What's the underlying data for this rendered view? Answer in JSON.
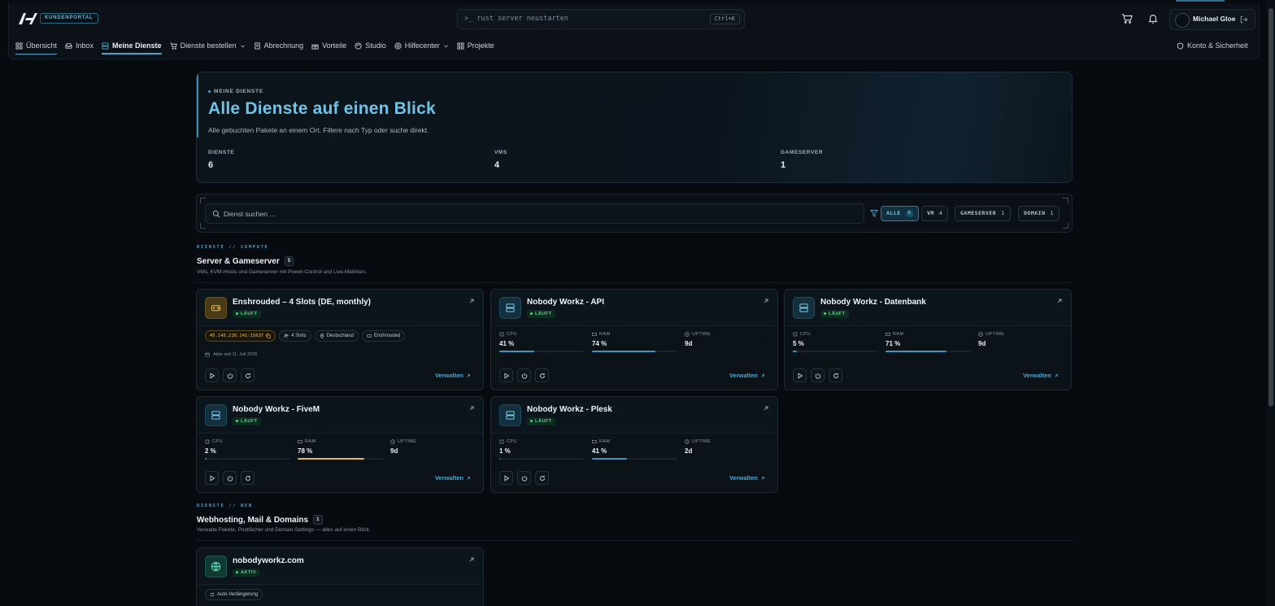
{
  "header": {
    "portal_badge": "KUNDENPORTAL",
    "command_placeholder": ">_ rust server neustarten",
    "command_shortcut": "Ctrl+K",
    "user_name": "Michael Gloe"
  },
  "nav": {
    "items": [
      {
        "label": "Übersicht",
        "icon": "grid-icon"
      },
      {
        "label": "Inbox",
        "icon": "inbox-icon"
      },
      {
        "label": "Meine Dienste",
        "icon": "server-icon"
      },
      {
        "label": "Dienste bestellen",
        "icon": "cart-icon"
      },
      {
        "label": "Abrechnung",
        "icon": "receipt-icon"
      },
      {
        "label": "Vorteile",
        "icon": "gift-icon"
      },
      {
        "label": "Studio",
        "icon": "palette-icon"
      },
      {
        "label": "Hilfecenter",
        "icon": "lifebuoy-icon"
      },
      {
        "label": "Projekte",
        "icon": "grid-icon"
      }
    ],
    "right": "Konto & Sicherheit"
  },
  "hero": {
    "eyebrow": "MEINE DIENSTE",
    "title": "Alle Dienste auf einen Blick",
    "subtitle": "Alle gebuchten Pakete an einem Ort. Filtere nach Typ oder suche direkt.",
    "stats": [
      {
        "label": "DIENSTE",
        "value": "6"
      },
      {
        "label": "VMS",
        "value": "4"
      },
      {
        "label": "GAMESERVER",
        "value": "1"
      }
    ]
  },
  "filters": {
    "search_placeholder": "Dienst suchen ...",
    "chips": [
      {
        "label": "ALLE",
        "count": "6",
        "active": true
      },
      {
        "label": "VM",
        "count": "4",
        "active": false
      },
      {
        "label": "GAMESERVER",
        "count": "1",
        "active": false
      },
      {
        "label": "DOMAIN",
        "count": "1",
        "active": false
      }
    ]
  },
  "sections": [
    {
      "eyebrow": "DIENSTE // COMPUTE",
      "title": "Server & Gameserver",
      "count": "5",
      "subtitle": "VMs, KVM-Hosts und Gameserver mit Power-Control und Live-Metriken."
    },
    {
      "eyebrow": "DIENSTE // WEB",
      "title": "Webhosting, Mail & Domains",
      "count": "1",
      "subtitle": "Verwalte Pakete, Postfächer und Domain-Settings — alles auf einen Blick."
    }
  ],
  "labels": {
    "cpu": "CPU",
    "ram": "RAM",
    "uptime": "UPTIME",
    "manage": "Verwalten",
    "running": "LÄUFT",
    "active": "AKTIV"
  },
  "cards": {
    "enshrouded": {
      "title": "Enshrouded – 4 Slots (DE, monthly)",
      "status": "LÄUFT",
      "ip": "45.145.226.141:15637",
      "slots": "4 Slots",
      "location": "Deutschland",
      "game": "Enshrouded",
      "since": "Aktiv seit 11. Juli 2026"
    },
    "api": {
      "title": "Nobody Workz - API",
      "cpu": "41 %",
      "ram": "74 %",
      "uptime": "9d",
      "cpu_pct": 41,
      "ram_pct": 74
    },
    "db": {
      "title": "Nobody Workz - Datenbank",
      "cpu": "5 %",
      "ram": "71 %",
      "uptime": "9d",
      "cpu_pct": 5,
      "ram_pct": 71
    },
    "fivem": {
      "title": "Nobody Workz - FiveM",
      "cpu": "2 %",
      "ram": "78 %",
      "uptime": "9d",
      "cpu_pct": 2,
      "ram_pct": 78
    },
    "plesk": {
      "title": "Nobody Workz - Plesk",
      "cpu": "1 %",
      "ram": "41 %",
      "uptime": "2d",
      "cpu_pct": 1,
      "ram_pct": 41
    },
    "domain": {
      "title": "nobodyworkz.com",
      "status": "AKTIV",
      "tag": "Auto-Verlängerung"
    }
  },
  "colors": {
    "accent": "#4aa8d2",
    "running": "#54d38c",
    "warning": "#e5b64a",
    "background": "#070b10"
  }
}
